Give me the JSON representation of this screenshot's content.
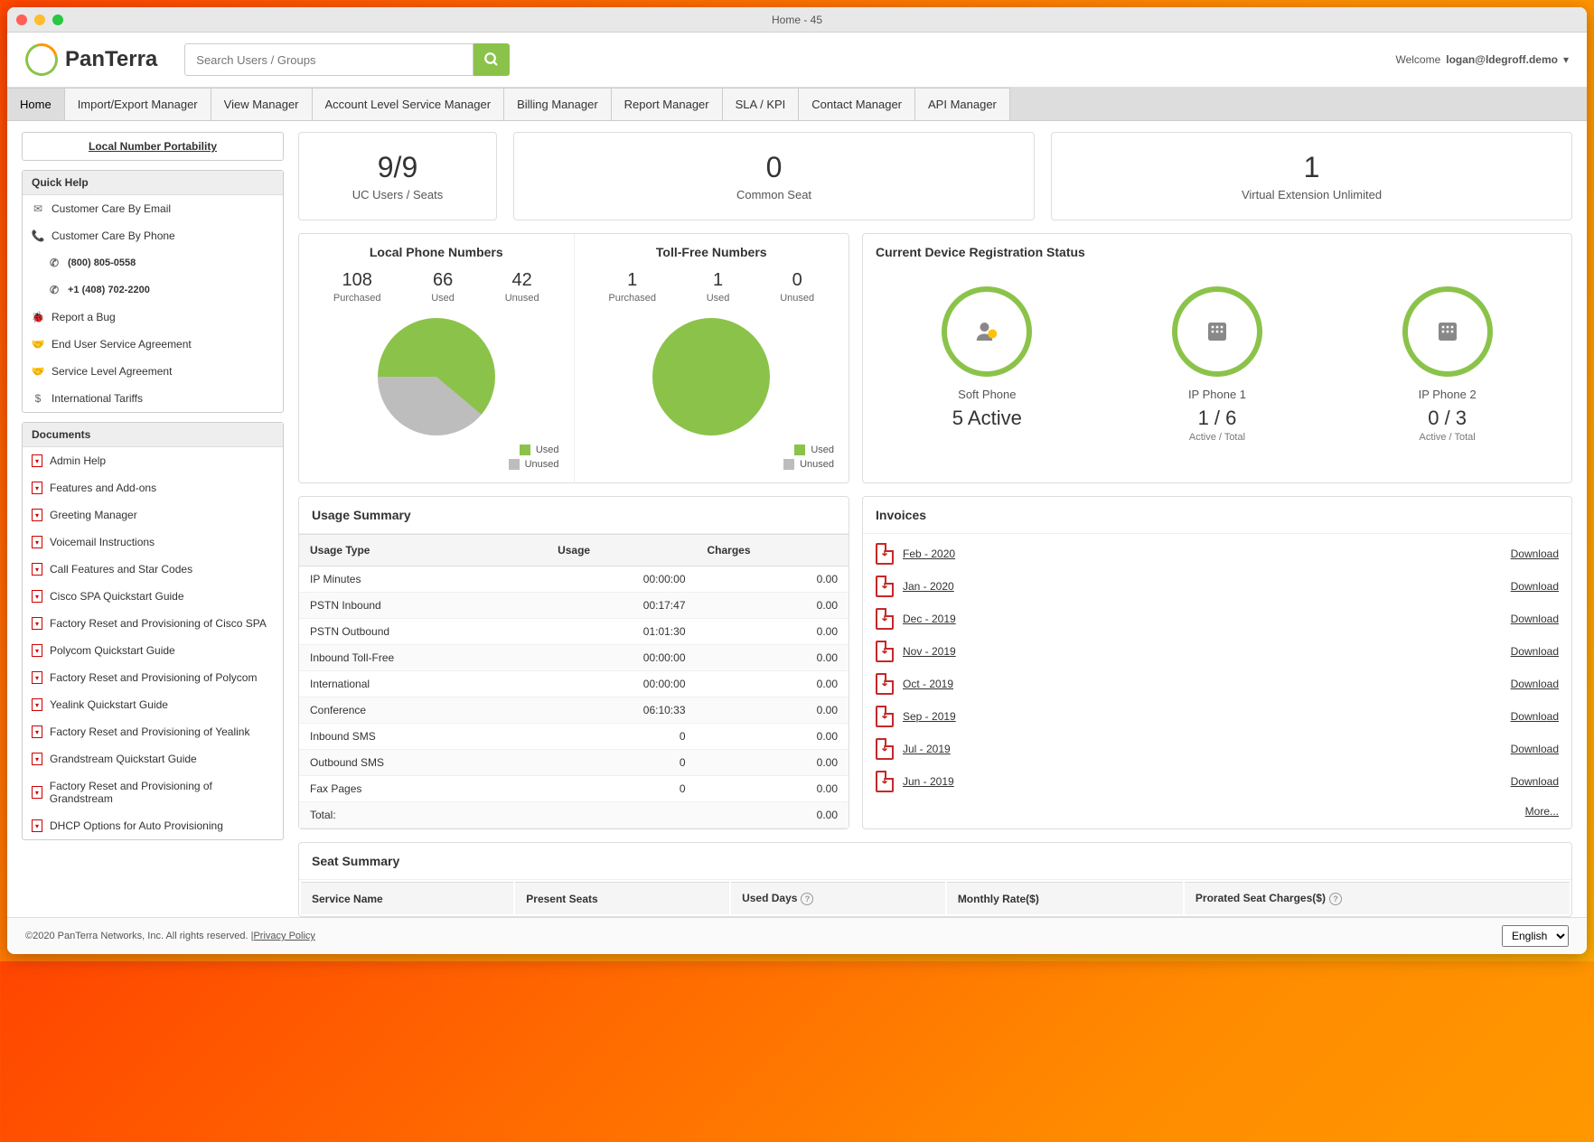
{
  "window_title": "Home - 45",
  "logo_text": "PanTerra",
  "search_placeholder": "Search Users / Groups",
  "welcome_prefix": "Welcome ",
  "welcome_user": "logan@ldegroff.demo",
  "nav_tabs": [
    "Home",
    "Import/Export Manager",
    "View Manager",
    "Account Level Service Manager",
    "Billing Manager",
    "Report Manager",
    "SLA / KPI",
    "Contact Manager",
    "API Manager"
  ],
  "sidebar": {
    "lnp_link": "Local Number Portability",
    "quick_help_title": "Quick Help",
    "quick_help": [
      "Customer Care By Email",
      "Customer Care By Phone",
      "Report a Bug",
      "End User Service Agreement",
      "Service Level Agreement",
      "International Tariffs"
    ],
    "phone1": "(800) 805-0558",
    "phone2": "+1 (408) 702-2200",
    "documents_title": "Documents",
    "documents": [
      "Admin Help",
      "Features and Add-ons",
      "Greeting Manager",
      "Voicemail Instructions",
      "Call Features and Star Codes",
      "Cisco SPA Quickstart Guide",
      "Factory Reset and Provisioning of Cisco SPA",
      "Polycom Quickstart Guide",
      "Factory Reset and Provisioning of Polycom",
      "Yealink Quickstart Guide",
      "Factory Reset and Provisioning of Yealink",
      "Grandstream Quickstart Guide",
      "Factory Reset and Provisioning of Grandstream",
      "DHCP Options for Auto Provisioning"
    ]
  },
  "stat_cards": [
    {
      "value": "9/9",
      "label": "UC Users / Seats"
    },
    {
      "value": "0",
      "label": "Common Seat"
    },
    {
      "value": "1",
      "label": "Virtual Extension Unlimited"
    }
  ],
  "local_numbers": {
    "title": "Local Phone Numbers",
    "purchased": "108",
    "purchased_lbl": "Purchased",
    "used": "66",
    "used_lbl": "Used",
    "unused": "42",
    "unused_lbl": "Unused"
  },
  "tollfree_numbers": {
    "title": "Toll-Free Numbers",
    "purchased": "1",
    "purchased_lbl": "Purchased",
    "used": "1",
    "used_lbl": "Used",
    "unused": "0",
    "unused_lbl": "Unused"
  },
  "legend": {
    "used": "Used",
    "unused": "Unused"
  },
  "device_reg_title": "Current Device Registration Status",
  "devices": [
    {
      "name": "Soft Phone",
      "value": "5 Active",
      "sub": ""
    },
    {
      "name": "IP Phone 1",
      "value": "1 / 6",
      "sub": "Active / Total"
    },
    {
      "name": "IP Phone 2",
      "value": "0 / 3",
      "sub": "Active / Total"
    }
  ],
  "usage_title": "Usage Summary",
  "usage_headers": [
    "Usage Type",
    "Usage",
    "Charges"
  ],
  "usage_rows": [
    [
      "IP Minutes",
      "00:00:00",
      "0.00"
    ],
    [
      "PSTN Inbound",
      "00:17:47",
      "0.00"
    ],
    [
      "PSTN Outbound",
      "01:01:30",
      "0.00"
    ],
    [
      "Inbound Toll-Free",
      "00:00:00",
      "0.00"
    ],
    [
      "International",
      "00:00:00",
      "0.00"
    ],
    [
      "Conference",
      "06:10:33",
      "0.00"
    ],
    [
      "Inbound SMS",
      "0",
      "0.00"
    ],
    [
      "Outbound SMS",
      "0",
      "0.00"
    ],
    [
      "Fax Pages",
      "0",
      "0.00"
    ],
    [
      "Total:",
      "",
      "0.00"
    ]
  ],
  "invoices_title": "Invoices",
  "invoices": [
    "Feb - 2020",
    "Jan - 2020",
    "Dec - 2019",
    "Nov - 2019",
    "Oct - 2019",
    "Sep - 2019",
    "Jul - 2019",
    "Jun - 2019"
  ],
  "download_label": "Download",
  "more_label": "More...",
  "seat_title": "Seat Summary",
  "seat_headers": [
    "Service Name",
    "Present Seats",
    "Used Days",
    "Monthly Rate($)",
    "Prorated Seat Charges($)"
  ],
  "footer_copyright": "©2020 PanTerra Networks, Inc. All rights reserved. | ",
  "footer_privacy": "Privacy Policy",
  "language": "English",
  "chart_data": [
    {
      "type": "pie",
      "title": "Local Phone Numbers",
      "series": [
        {
          "name": "Used",
          "value": 66,
          "color": "#8bc34a"
        },
        {
          "name": "Unused",
          "value": 42,
          "color": "#bdbdbd"
        }
      ]
    },
    {
      "type": "pie",
      "title": "Toll-Free Numbers",
      "series": [
        {
          "name": "Used",
          "value": 1,
          "color": "#8bc34a"
        },
        {
          "name": "Unused",
          "value": 0,
          "color": "#bdbdbd"
        }
      ]
    }
  ],
  "colors": {
    "accent": "#8bc34a",
    "gray": "#bdbdbd"
  }
}
